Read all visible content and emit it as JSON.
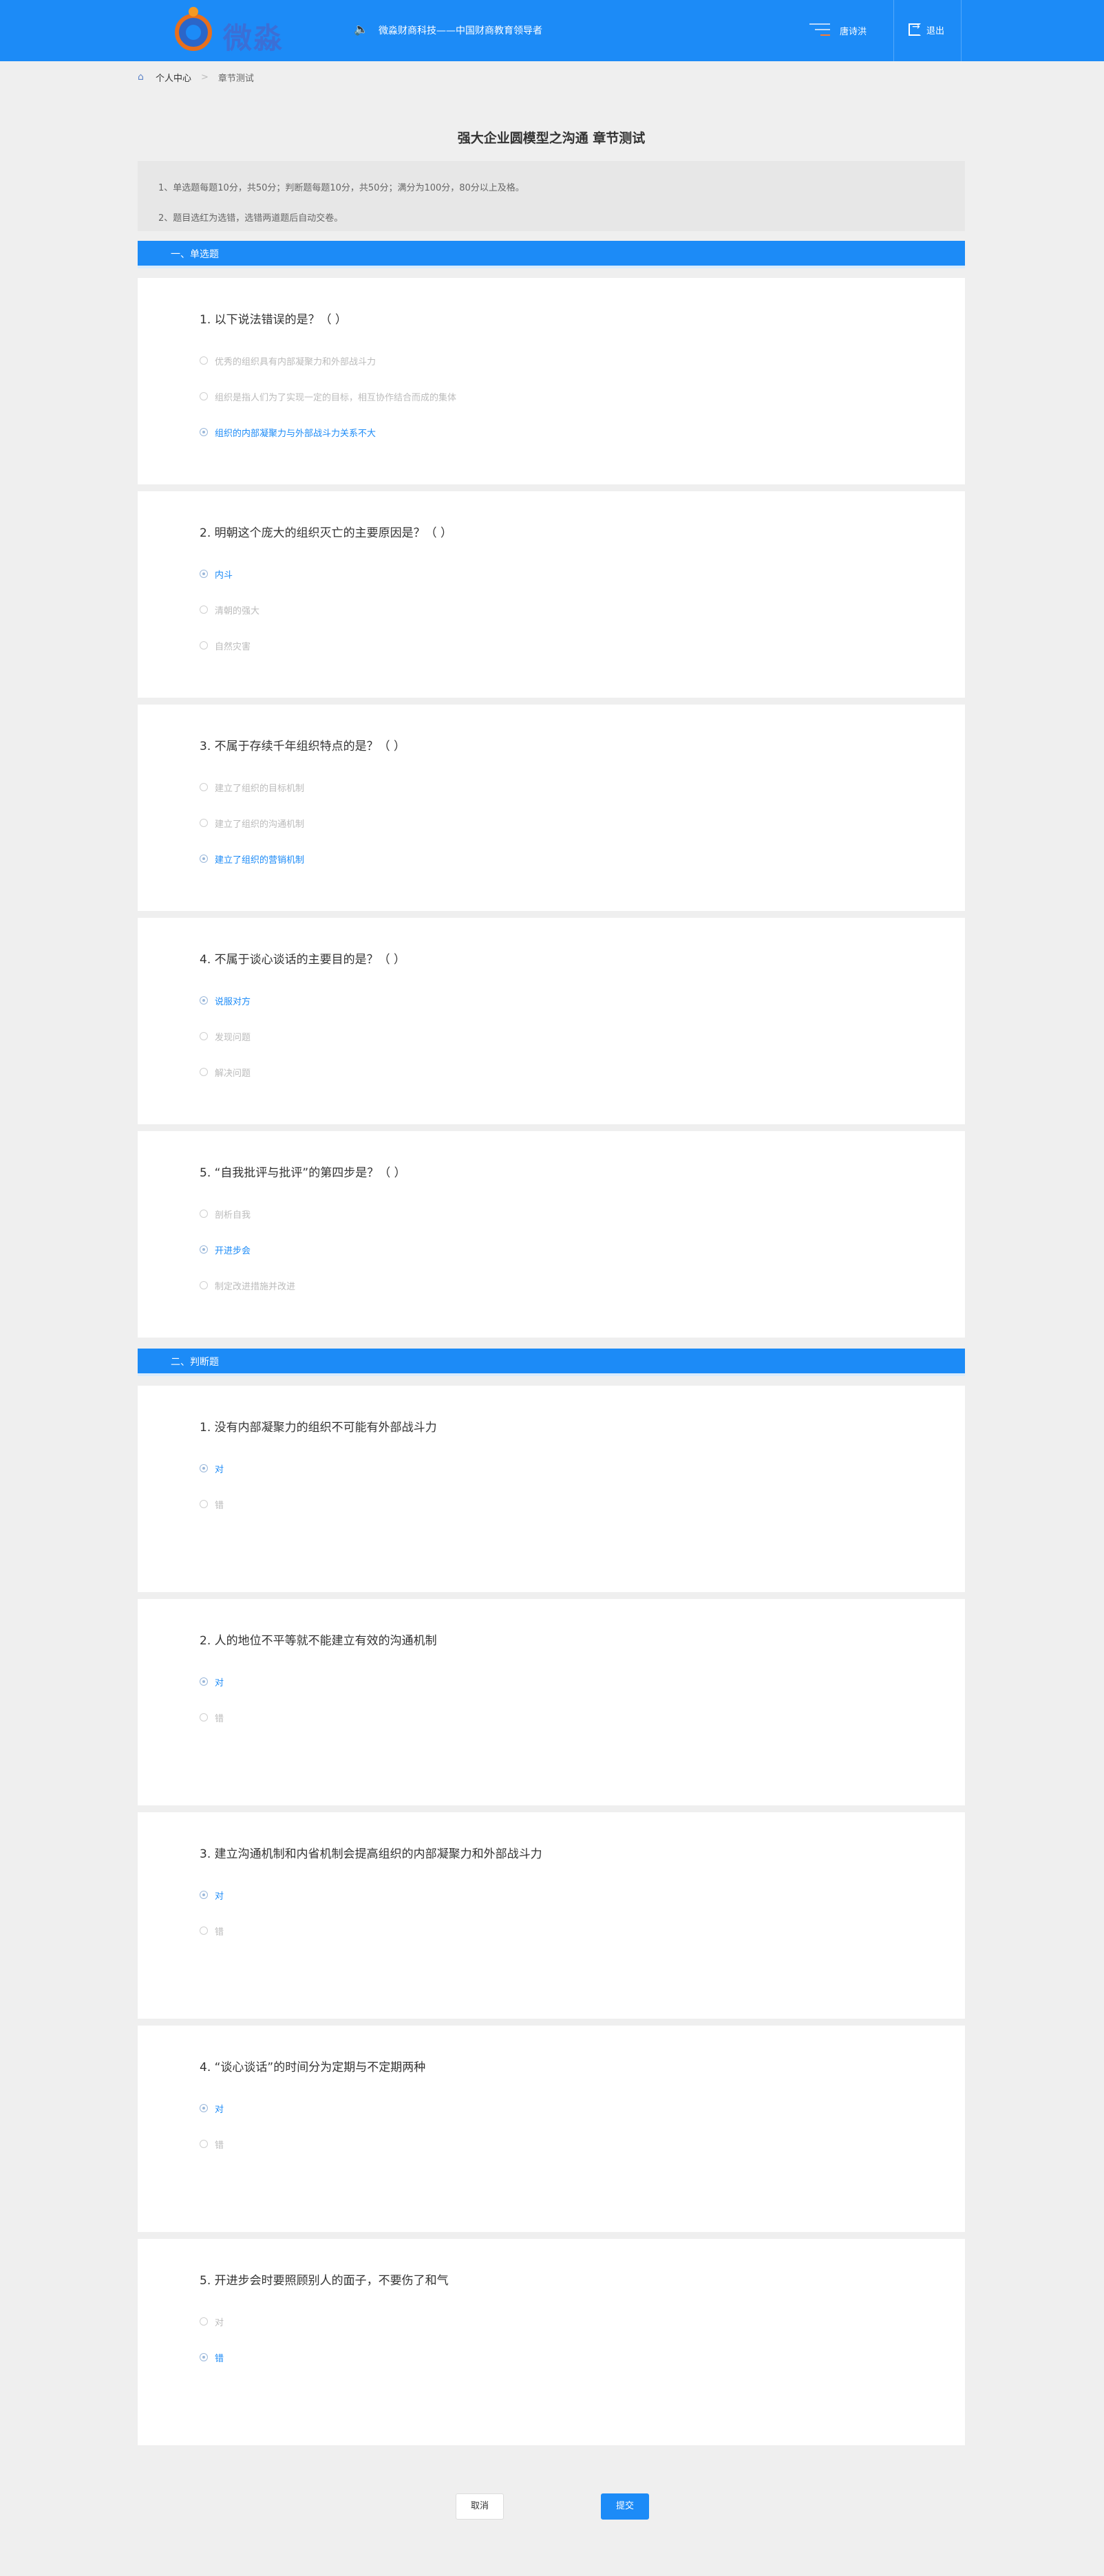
{
  "header": {
    "logo_text": "微淼",
    "headline": "微淼财商科技——中国财商教育领导者",
    "user_name": "唐诗洪",
    "logout_label": "退出"
  },
  "breadcrumb": {
    "home": "个人中心",
    "separator": ">",
    "current": "章节测试"
  },
  "page_title": "强大企业圆模型之沟通 章节测试",
  "notice": [
    "1、单选题每题10分，共50分；判断题每题10分，共50分；满分为100分，80分以上及格。",
    "2、题目选红为选错，选错两道题后自动交卷。"
  ],
  "section1": {
    "title": "一、单选题",
    "questions": [
      {
        "title": "1. 以下说法错误的是？（ ）",
        "options": [
          "优秀的组织具有内部凝聚力和外部战斗力",
          "组织是指人们为了实现一定的目标，相互协作结合而成的集体",
          "组织的内部凝聚力与外部战斗力关系不大"
        ]
      },
      {
        "title": "2. 明朝这个庞大的组织灭亡的主要原因是？（ ）",
        "options": [
          "内斗",
          "清朝的强大",
          "自然灾害"
        ]
      },
      {
        "title": "3. 不属于存续千年组织特点的是？（ ）",
        "options": [
          "建立了组织的目标机制",
          "建立了组织的沟通机制",
          "建立了组织的营销机制"
        ]
      },
      {
        "title": "4. 不属于谈心谈话的主要目的是？（ ）",
        "options": [
          "说服对方",
          "发现问题",
          "解决问题"
        ]
      },
      {
        "title": "5. “自我批评与批评”的第四步是？（ ）",
        "options": [
          "剖析自我",
          "开进步会",
          "制定改进措施并改进"
        ]
      }
    ]
  },
  "section2": {
    "title": "二、判断题",
    "questions": [
      {
        "title": "1. 没有内部凝聚力的组织不可能有外部战斗力",
        "options": [
          "对",
          "错"
        ]
      },
      {
        "title": "2. 人的地位不平等就不能建立有效的沟通机制",
        "options": [
          "对",
          "错"
        ]
      },
      {
        "title": "3. 建立沟通机制和内省机制会提高组织的内部凝聚力和外部战斗力",
        "options": [
          "对",
          "错"
        ]
      },
      {
        "title": "4. “谈心谈话”的时间分为定期与不定期两种",
        "options": [
          "对",
          "错"
        ]
      },
      {
        "title": "5. 开进步会时要照顾别人的面子，不要伤了和气",
        "options": [
          "对",
          "错"
        ]
      }
    ]
  },
  "buttons": {
    "cancel": "取消",
    "submit": "提交"
  },
  "colors": {
    "primary": "#1c8bf7",
    "selected_text": "#1c8bf7",
    "unselected_text": "#bbbbbb"
  }
}
